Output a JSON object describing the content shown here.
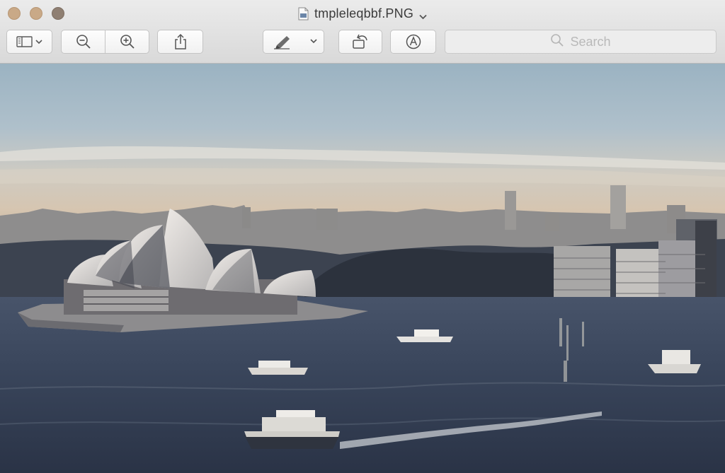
{
  "window": {
    "title": "tmpleleqbbf.PNG"
  },
  "toolbar": {
    "sidebar_button": "sidebar-icon",
    "zoom_out_button": "zoom-out-icon",
    "zoom_in_button": "zoom-in-icon",
    "share_button": "share-icon",
    "markup_button": "pen-icon",
    "rotate_button": "rotate-icon",
    "annotate_button": "markup-icon",
    "search_placeholder": "Search"
  },
  "content": {
    "image_subject": "sydney-harbour-photo"
  },
  "colors": {
    "titlebar": "#e3e3e3",
    "sky_top": "#9eb7c6",
    "water": "#344258"
  }
}
